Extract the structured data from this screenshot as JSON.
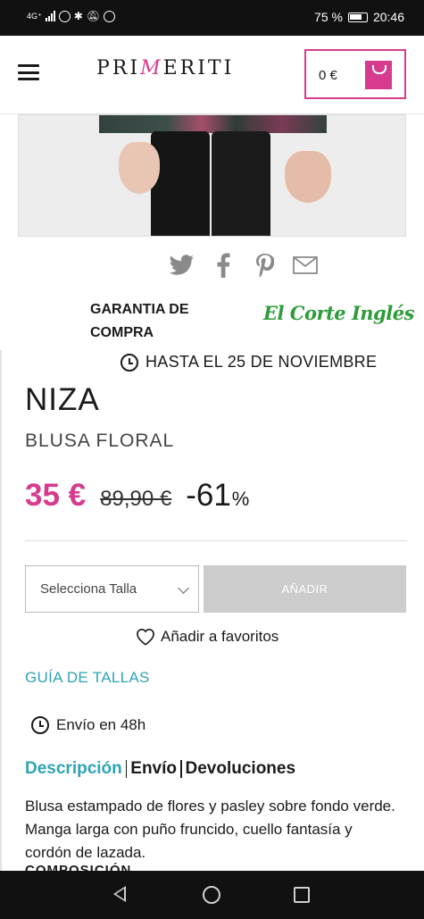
{
  "status_bar": {
    "network": "4G⁺",
    "battery": "75 %",
    "time": "20:46"
  },
  "header": {
    "logo": "PRIMERITI",
    "cart_total": "0 €"
  },
  "share": {
    "icons": [
      "twitter-icon",
      "facebook-icon",
      "pinterest-icon",
      "mail-icon"
    ]
  },
  "guarantee": {
    "text": "GARANTIA DE COMPRA",
    "brand": "El Corte Inglés"
  },
  "product": {
    "deadline": "HASTA EL 25 DE NOVIEMBRE",
    "name": "NIZA",
    "subtitle": "BLUSA FLORAL",
    "price_now": "35 €",
    "price_old": "89,90 €",
    "discount": "-61",
    "discount_unit": "%",
    "size_placeholder": "Selecciona Talla",
    "add_button": "AÑADIR",
    "favorites": "Añadir a favoritos",
    "size_guide": "GUÍA DE TALLAS",
    "shipping": "Envío en 48h"
  },
  "tabs": {
    "description": "Descripción",
    "shipping": "Envío",
    "returns": "Devoluciones"
  },
  "description": {
    "text": "Blusa estampado de flores y pasley sobre fondo verde. Manga larga con puño fruncido, cuello fantasía y cordón de lazada.",
    "next_heading": "COMPOSICIÓN"
  },
  "colors": {
    "brand_pink": "#d63b8e",
    "link_teal": "#2fa3b6",
    "eci_green": "#2e9c3a",
    "disabled_button": "#cccccc"
  }
}
